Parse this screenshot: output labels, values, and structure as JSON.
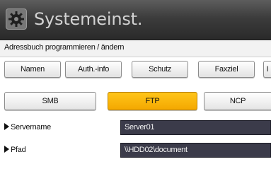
{
  "header": {
    "title": "Systemeinst.",
    "icon": "gear-icon"
  },
  "page": {
    "subtitle": "Adressbuch programmieren / ändern"
  },
  "tabs": [
    {
      "label": "Namen"
    },
    {
      "label": "Auth.-info"
    },
    {
      "label": "Schutz"
    },
    {
      "label": "Faxziel"
    },
    {
      "label": "I"
    }
  ],
  "protocols": [
    {
      "label": "SMB",
      "selected": false
    },
    {
      "label": "FTP",
      "selected": true
    },
    {
      "label": "NCP",
      "selected": false
    }
  ],
  "fields": [
    {
      "label": "Servername",
      "value": "Server01"
    },
    {
      "label": "Pfad",
      "value": "\\\\HDD02\\document"
    }
  ],
  "colors": {
    "selected": "#f4a800",
    "field_bg": "#3b3b4a",
    "header_bg": "#3c3c3c"
  }
}
